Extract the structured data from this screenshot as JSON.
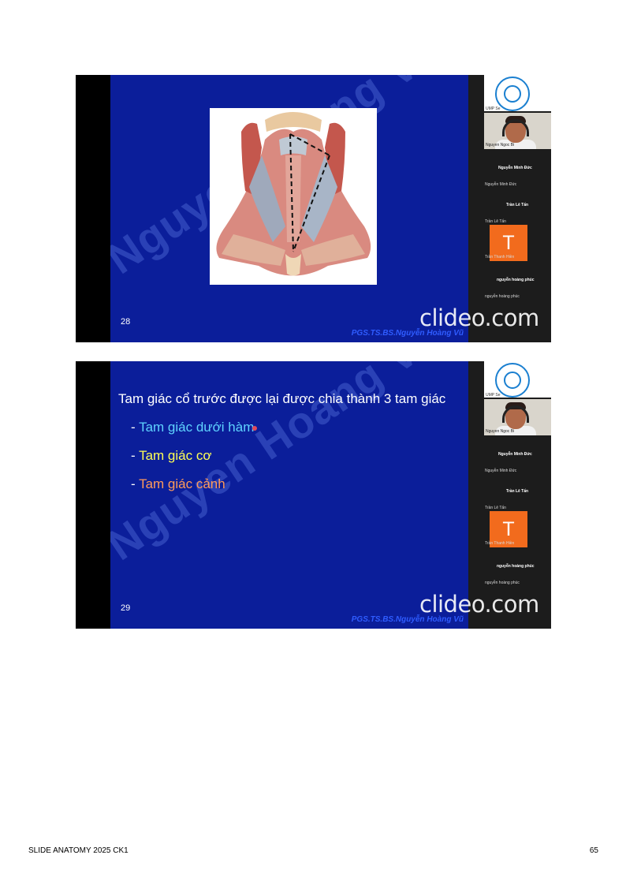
{
  "slide_a": {
    "number": "28",
    "watermark": "Nguyen Hoang Vu",
    "author": "PGS.TS.BS.Nguyễn Hoàng Vũ",
    "overlay_logo": "clideo.com"
  },
  "slide_b": {
    "number": "29",
    "watermark": "Nguyen Hoang Vu",
    "author": "PGS.TS.BS.Nguyễn Hoàng Vũ",
    "overlay_logo": "clideo.com",
    "heading": "Tam giác cổ trước được lại được chia thành 3 tam giác",
    "bullets": [
      {
        "dash": "- ",
        "text": "Tam giác dưới hàm",
        "color": "#5fd3ff"
      },
      {
        "dash": "- ",
        "text": "Tam giác cơ",
        "color": "#ffff55"
      },
      {
        "dash": "- ",
        "text": "Tam giác cảnh",
        "color": "#ff9a5a"
      }
    ]
  },
  "participants": {
    "self_label": "UMP Se",
    "video_name": "Nguyen Ngoc Bi",
    "p1_title": "Nguyễn Minh Đức",
    "p1_name": "Nguyễn Minh Đức",
    "p2_title": "Trần Lê Tấn",
    "p2_name": "Trần Lê Tấn",
    "tile_letter": "T",
    "tile_name": "Trần Thanh Hiền",
    "p3_title": "nguyễn hoàng phúc",
    "p3_name": "nguyễn hoàng phúc"
  },
  "footer": {
    "left": "SLIDE ANATOMY 2025 CK1",
    "right": "65"
  },
  "colors": {
    "slide_bg": "#0b1e9a",
    "tile": "#f26b1d"
  }
}
